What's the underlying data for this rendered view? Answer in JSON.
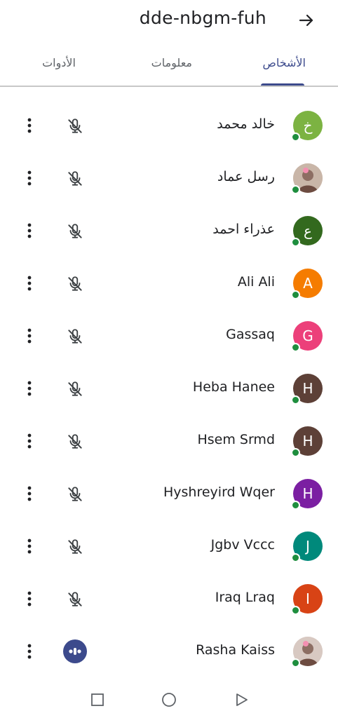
{
  "header": {
    "meeting_code": "dde-nbgm-fuh",
    "back_icon": "arrow-right-icon"
  },
  "tabs": [
    {
      "label": "الأشخاص",
      "active": true
    },
    {
      "label": "معلومات",
      "active": false
    },
    {
      "label": "الأدوات",
      "active": false
    }
  ],
  "colors": {
    "accent": "#3c4a8c",
    "online": "#1e8e3e"
  },
  "participants": [
    {
      "name": "خالد محمد",
      "initial": "خ",
      "avatar_color": "#7cb342",
      "photo": false,
      "mic": "muted"
    },
    {
      "name": "رسل عماد",
      "initial": "",
      "avatar_color": "#c9b6a8",
      "photo": true,
      "mic": "muted"
    },
    {
      "name": "عذراء احمد",
      "initial": "ع",
      "avatar_color": "#33691e",
      "photo": false,
      "mic": "muted"
    },
    {
      "name": "Ali Ali",
      "initial": "A",
      "avatar_color": "#f57c00",
      "photo": false,
      "mic": "muted"
    },
    {
      "name": "Gassaq",
      "initial": "G",
      "avatar_color": "#ec407a",
      "photo": false,
      "mic": "muted"
    },
    {
      "name": "Heba Hanee",
      "initial": "H",
      "avatar_color": "#5d4037",
      "photo": false,
      "mic": "muted"
    },
    {
      "name": "Hsem Srmd",
      "initial": "H",
      "avatar_color": "#5d4037",
      "photo": false,
      "mic": "muted"
    },
    {
      "name": "Hyshreyird Wqer",
      "initial": "H",
      "avatar_color": "#7b1fa2",
      "photo": false,
      "mic": "muted"
    },
    {
      "name": "Jgbv Vccc",
      "initial": "J",
      "avatar_color": "#00897b",
      "photo": false,
      "mic": "muted"
    },
    {
      "name": "Iraq Lraq",
      "initial": "I",
      "avatar_color": "#d84315",
      "photo": false,
      "mic": "muted"
    },
    {
      "name": "Rasha Kaiss",
      "initial": "",
      "avatar_color": "#d8c9c2",
      "photo": true,
      "mic": "speaking"
    }
  ],
  "navbar": {
    "icons": [
      "recents-square-icon",
      "home-circle-icon",
      "back-triangle-icon"
    ]
  }
}
